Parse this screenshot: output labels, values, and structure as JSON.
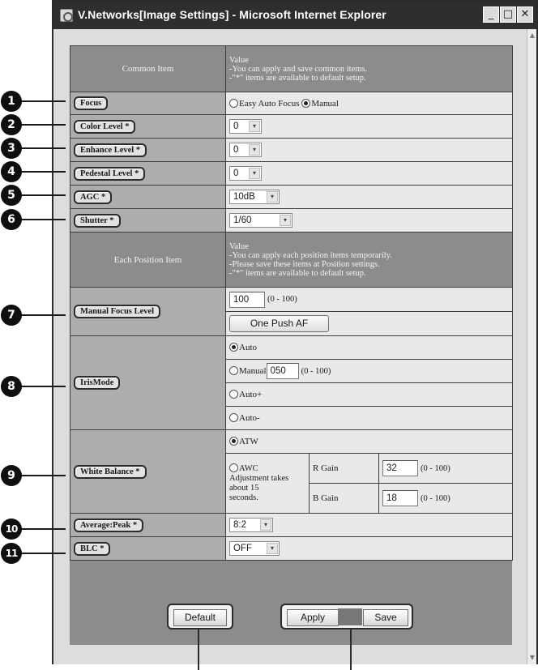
{
  "window": {
    "title": "V.Networks[Image Settings] - Microsoft Internet Explorer",
    "min_glyph": "_",
    "max_glyph": "□",
    "close_glyph": "✕"
  },
  "common": {
    "header_item": "Common Item",
    "header_value_lines": [
      "Value",
      "-You can apply and save common items.",
      "-\"*\" items are available to default setup."
    ]
  },
  "focus": {
    "label": "Focus",
    "option_easy": "Easy Auto Focus",
    "option_manual": "Manual",
    "selected": "Manual"
  },
  "color_level": {
    "label": "Color Level *",
    "value": "0"
  },
  "enhance_level": {
    "label": "Enhance Level *",
    "value": "0"
  },
  "pedestal_level": {
    "label": "Pedestal Level *",
    "value": "0"
  },
  "agc": {
    "label": "AGC *",
    "value": "10dB"
  },
  "shutter": {
    "label": "Shutter *",
    "value": "1/60"
  },
  "position": {
    "header_item": "Each Position Item",
    "header_value_lines": [
      "Value",
      "-You can apply each position items temporarily.",
      "-Please save these items at Position settings.",
      "-\"*\" items are available to default setup."
    ]
  },
  "manual_focus": {
    "label": "Manual Focus Level",
    "value": "100",
    "range": "(0 - 100)",
    "button": "One Push AF"
  },
  "iris": {
    "label": "IrisMode",
    "option_auto": "Auto",
    "option_manual": "Manual",
    "manual_value": "050",
    "range": "(0 - 100)",
    "option_auto_plus": "Auto+",
    "option_auto_minus": "Auto-",
    "selected": "Auto"
  },
  "white_balance": {
    "label": "White Balance *",
    "option_atw": "ATW",
    "option_awc": "AWC",
    "awc_note_lines": [
      "Adjustment takes",
      "about 15",
      "seconds."
    ],
    "r_gain_label": "R Gain",
    "r_gain_value": "32",
    "b_gain_label": "B Gain",
    "b_gain_value": "18",
    "range": "(0 - 100)",
    "selected": "ATW"
  },
  "average_peak": {
    "label": "Average:Peak *",
    "value": "8:2"
  },
  "blc": {
    "label": "BLC *",
    "value": "OFF"
  },
  "buttons": {
    "default": "Default",
    "apply": "Apply",
    "save": "Save"
  },
  "callouts": [
    "1",
    "2",
    "3",
    "4",
    "5",
    "6",
    "7",
    "8",
    "9",
    "10",
    "11"
  ],
  "icons": {
    "dropdown": "▾",
    "scroll_up": "▲",
    "scroll_down": "▼"
  }
}
